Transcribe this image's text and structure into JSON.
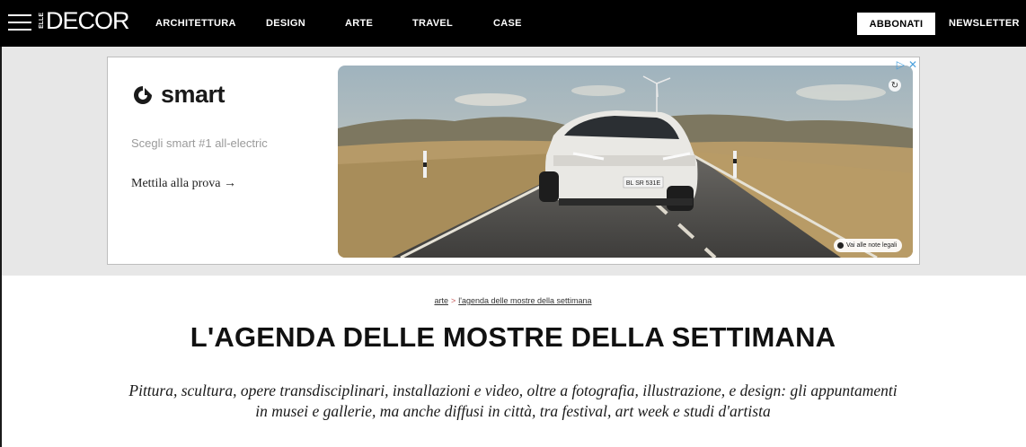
{
  "header": {
    "logo_prefix": "ELLE",
    "logo_text": "DECOR",
    "nav_items": [
      "ARCHITETTURA",
      "DESIGN",
      "ARTE",
      "TRAVEL",
      "CASE"
    ],
    "subscribe_label": "ABBONATI",
    "newsletter_label": "NEWSLETTER"
  },
  "ad": {
    "brand": "smart",
    "tagline": "Scegli smart #1 all-electric",
    "cta": "Mettila alla prova →",
    "legal_notes": "Vai alle note legali",
    "license_plate": "BL SR 531E",
    "icons": [
      "adchoices-icon",
      "close-icon",
      "replay-icon",
      "info-icon"
    ]
  },
  "article": {
    "breadcrumb_section": "arte",
    "breadcrumb_separator": ">",
    "breadcrumb_current": "l'agenda delle mostre della settimana",
    "title": "L'AGENDA DELLE MOSTRE DELLA SETTIMANA",
    "dek_line1": "Pittura, scultura, opere transdisciplinari, installazioni e video, oltre a fotografia, illustrazione, e design: gli appuntamenti",
    "dek_line2": "in musei e gallerie, ma anche diffusi in città, tra festival, art week e studi d'artista"
  },
  "colors": {
    "nav_bg": "#000000",
    "ad_band_bg": "#e7e7e7",
    "adchoices": "#4aa0dc"
  }
}
